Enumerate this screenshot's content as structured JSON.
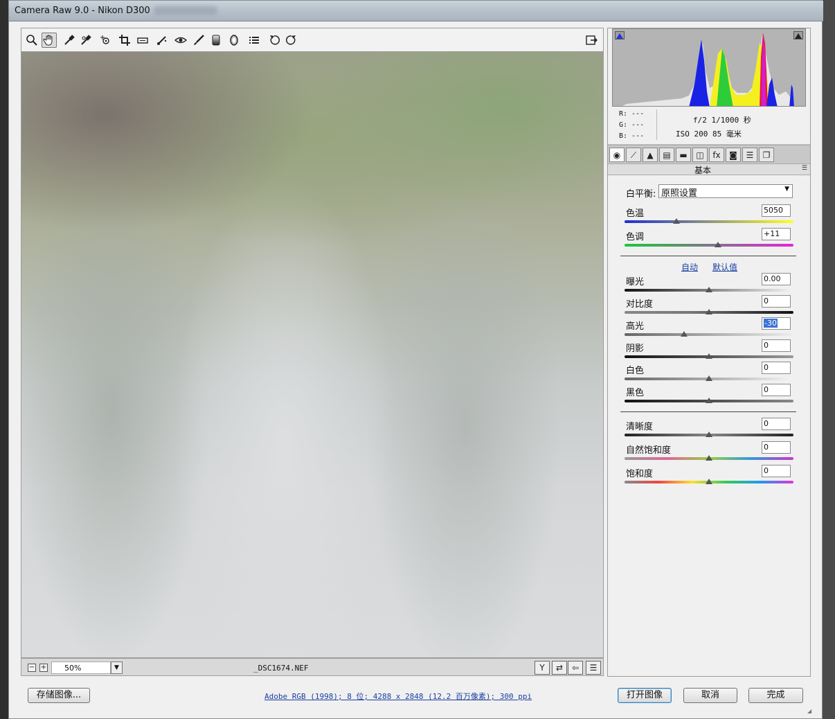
{
  "window": {
    "title": "Camera Raw 9.0 -  Nikon D300"
  },
  "toolbar": {
    "tools": [
      {
        "name": "zoom-tool",
        "icon": "magnifier-icon"
      },
      {
        "name": "hand-tool",
        "icon": "hand-icon",
        "active": true
      },
      {
        "name": "white-balance-tool",
        "icon": "eyedropper-icon"
      },
      {
        "name": "color-sampler-tool",
        "icon": "sampler-icon"
      },
      {
        "name": "targeted-adjustment-tool",
        "icon": "target-icon"
      },
      {
        "name": "crop-tool",
        "icon": "crop-icon"
      },
      {
        "name": "straighten-tool",
        "icon": "level-icon"
      },
      {
        "name": "spot-removal-tool",
        "icon": "brush-spot-icon"
      },
      {
        "name": "red-eye-tool",
        "icon": "eye-icon"
      },
      {
        "name": "adjustment-brush-tool",
        "icon": "brush-icon"
      },
      {
        "name": "graduated-filter-tool",
        "icon": "gradient-icon"
      },
      {
        "name": "radial-filter-tool",
        "icon": "radial-icon"
      },
      {
        "name": "preferences",
        "icon": "list-icon"
      },
      {
        "name": "rotate-ccw",
        "icon": "rotate-left-icon"
      },
      {
        "name": "rotate-cw",
        "icon": "rotate-right-icon"
      }
    ],
    "fullscreen_icon": "fullscreen-icon"
  },
  "status": {
    "zoom_out": "−",
    "zoom_in": "+",
    "zoom": "50%",
    "filename": "_DSC1674.NEF"
  },
  "exif": {
    "r": "R:  ---",
    "g": "G:  ---",
    "b": "B:  ---",
    "line1": "f/2  1/1000 秒",
    "line2": "ISO 200  85 毫米"
  },
  "panel": {
    "title": "基本",
    "wb_label": "白平衡:",
    "wb_value": "原照设置",
    "temp_label": "色温",
    "temp_value": "5050",
    "tint_label": "色调",
    "tint_value": "+11",
    "auto": "自动",
    "default": "默认值",
    "exposure_label": "曝光",
    "exposure_value": "0.00",
    "contrast_label": "对比度",
    "contrast_value": "0",
    "highlights_label": "高光",
    "highlights_value": "-30",
    "shadows_label": "阴影",
    "shadows_value": "0",
    "whites_label": "白色",
    "whites_value": "0",
    "blacks_label": "黑色",
    "blacks_value": "0",
    "clarity_label": "清晰度",
    "clarity_value": "0",
    "vibrance_label": "自然饱和度",
    "vibrance_value": "0",
    "saturation_label": "饱和度",
    "saturation_value": "0"
  },
  "footer": {
    "save": "存储图像...",
    "workflow": "Adobe RGB (1998); 8 位; 4288 x 2848 (12.2 百万像素); 300 ppi",
    "open": "打开图像",
    "cancel": "取消",
    "done": "完成"
  }
}
